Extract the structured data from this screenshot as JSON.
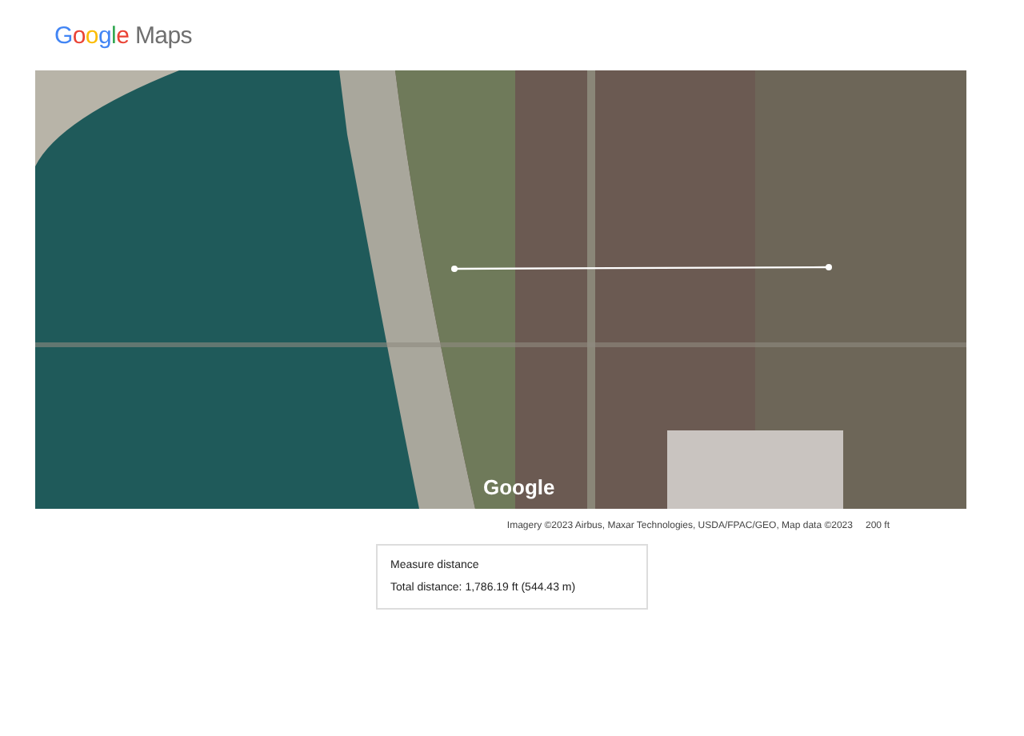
{
  "header": {
    "logo_word": "Google",
    "product": "Maps"
  },
  "map": {
    "watermark": "Google"
  },
  "attribution": "Imagery ©2023 Airbus, Maxar Technologies, USDA/FPAC/GEO, Map data ©2023",
  "scale": "200 ft",
  "measure": {
    "title": "Measure distance",
    "total": "Total distance: 1,786.19 ft (544.43 m)"
  }
}
